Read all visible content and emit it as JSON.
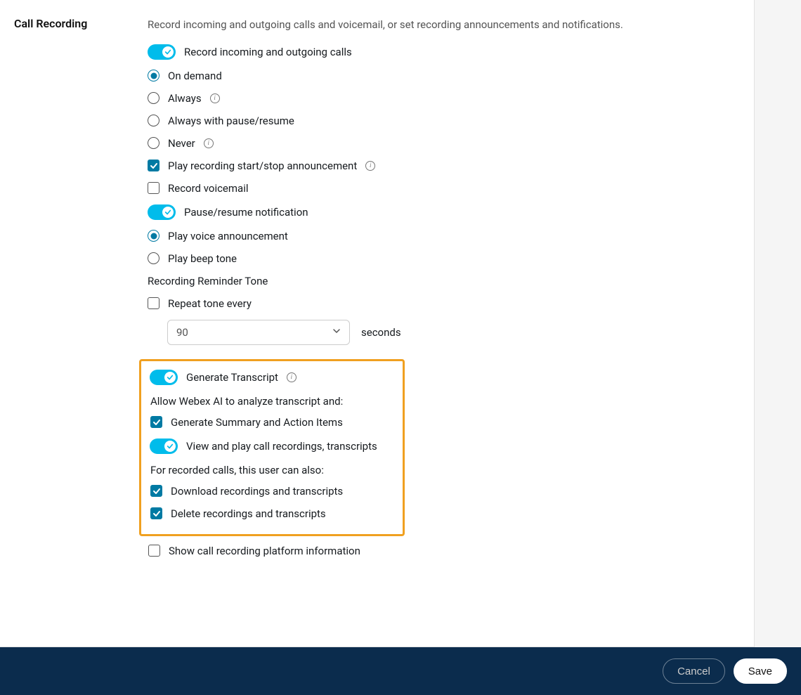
{
  "section_title": "Call Recording",
  "description": "Record incoming and outgoing calls and voicemail, or set recording announcements and notifications.",
  "toggles": {
    "record_calls": "Record incoming and outgoing calls",
    "pause_resume_notification": "Pause/resume notification",
    "generate_transcript": "Generate Transcript",
    "view_play": "View and play call recordings, transcripts"
  },
  "radios": {
    "record_modes": {
      "on_demand": "On demand",
      "always": "Always",
      "always_pause_resume": "Always with pause/resume",
      "never": "Never"
    },
    "notification_modes": {
      "voice_announcement": "Play voice announcement",
      "beep_tone": "Play beep tone"
    }
  },
  "checkboxes": {
    "play_start_stop": "Play recording start/stop announcement",
    "record_voicemail": "Record voicemail",
    "repeat_tone": "Repeat tone every",
    "generate_summary": "Generate Summary and Action Items",
    "download_rt": "Download recordings and transcripts",
    "delete_rt": "Delete recordings and transcripts",
    "show_platform": "Show call recording platform information"
  },
  "labels": {
    "recording_reminder_tone": "Recording Reminder Tone",
    "seconds_unit": "seconds",
    "select_value": "90",
    "allow_ai": "Allow Webex AI to analyze transcript and:",
    "for_recorded_calls": "For recorded calls, this user can also:"
  },
  "footer": {
    "cancel": "Cancel",
    "save": "Save"
  }
}
